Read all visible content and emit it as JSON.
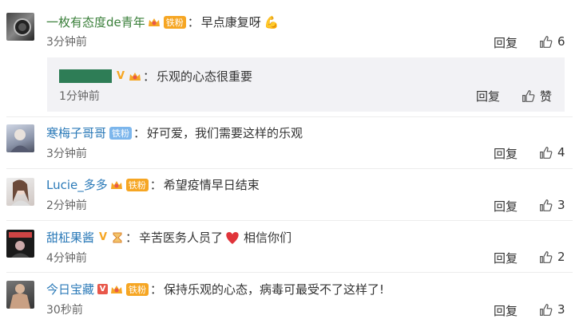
{
  "comments": [
    {
      "user": "一枚有态度de青年",
      "badge": "铁粉",
      "text": "早点康复呀",
      "time": "3分钟前",
      "reply": "回复",
      "likes": "6"
    },
    {
      "user": "寒梅子哥哥",
      "badge": "铁粉",
      "text": "好可爱，我们需要这样的乐观",
      "time": "3分钟前",
      "reply": "回复",
      "likes": "4"
    },
    {
      "user": "Lucie_多多",
      "badge": "铁粉",
      "text": "希望疫情早日结束",
      "time": "2分钟前",
      "reply": "回复",
      "likes": "3"
    },
    {
      "user": "甜柾果酱",
      "text_before": "辛苦医务人员了",
      "text_after": "相信你们",
      "time": "4分钟前",
      "reply": "回复",
      "likes": "2"
    },
    {
      "user": "今日宝藏",
      "badge": "铁粉",
      "text": "保持乐观的心态，病毒可最受不了这样了!",
      "time": "30秒前",
      "reply": "回复",
      "likes": "3"
    }
  ],
  "sub_reply": {
    "text": "乐观的心态很重要",
    "time": "1分钟前",
    "reply": "回复",
    "like": "赞"
  },
  "sep": "：",
  "colors": {
    "username": "#3a7f3a",
    "badge_fan": "#f6a623",
    "heart": "#e0343a"
  }
}
